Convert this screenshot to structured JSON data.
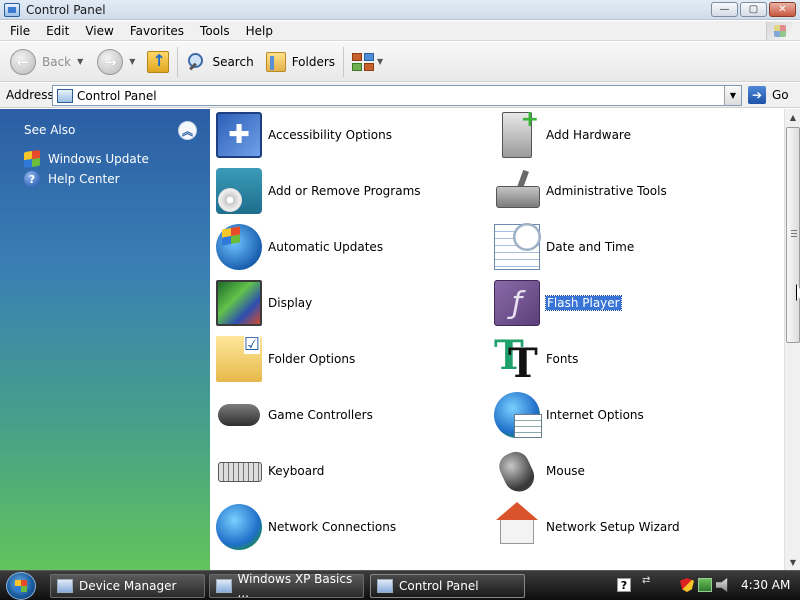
{
  "window": {
    "title": "Control Panel",
    "minimize_glyph": "—",
    "maximize_glyph": "▢",
    "close_glyph": "✕"
  },
  "menu": [
    "File",
    "Edit",
    "View",
    "Favorites",
    "Tools",
    "Help"
  ],
  "toolbar": {
    "back_label": "Back",
    "search_label": "Search",
    "folders_label": "Folders",
    "back_glyph": "←",
    "forward_glyph": "→",
    "caret_glyph": "▼"
  },
  "address": {
    "label": "Address",
    "value": "Control Panel",
    "go_label": "Go",
    "go_glyph": "➔",
    "dropdown_glyph": "▼"
  },
  "sidebar": {
    "heading": "See Also",
    "collapse_glyph": "︽",
    "links": [
      {
        "label": "Windows Update",
        "icon": "windows-update-icon"
      },
      {
        "label": "Help Center",
        "icon": "help-icon"
      }
    ],
    "help_glyph": "?"
  },
  "items": [
    {
      "label": "Accessibility Options",
      "icon": "accessibility-icon"
    },
    {
      "label": "Add Hardware",
      "icon": "add-hardware-icon"
    },
    {
      "label": "Add or Remove Programs",
      "icon": "add-remove-programs-icon"
    },
    {
      "label": "Administrative Tools",
      "icon": "administrative-tools-icon"
    },
    {
      "label": "Automatic Updates",
      "icon": "automatic-updates-icon"
    },
    {
      "label": "Date and Time",
      "icon": "date-time-icon"
    },
    {
      "label": "Display",
      "icon": "display-icon"
    },
    {
      "label": "Flash Player",
      "icon": "flash-player-icon",
      "selected": true
    },
    {
      "label": "Folder Options",
      "icon": "folder-options-icon"
    },
    {
      "label": "Fonts",
      "icon": "fonts-icon"
    },
    {
      "label": "Game Controllers",
      "icon": "game-controllers-icon"
    },
    {
      "label": "Internet Options",
      "icon": "internet-options-icon"
    },
    {
      "label": "Keyboard",
      "icon": "keyboard-icon"
    },
    {
      "label": "Mouse",
      "icon": "mouse-icon"
    },
    {
      "label": "Network Connections",
      "icon": "network-connections-icon"
    },
    {
      "label": "Network Setup Wizard",
      "icon": "network-setup-wizard-icon"
    }
  ],
  "scrollbar": {
    "up_glyph": "▲",
    "down_glyph": "▼"
  },
  "taskbar": {
    "tasks": [
      "Device Manager",
      "Windows XP Basics ...",
      "Control Panel"
    ],
    "clock": "4:30 AM",
    "help_glyph": "?",
    "tray_arrow_glyph": "⇄"
  }
}
